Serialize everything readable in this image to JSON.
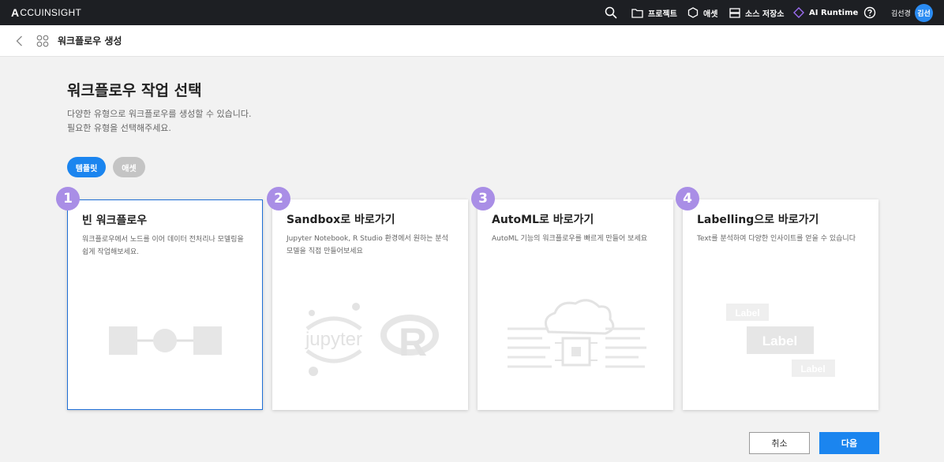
{
  "app": {
    "logo_text": "CCUINSIGHT",
    "logo_mark": "A"
  },
  "nav": {
    "items": [
      {
        "label": "프로젝트",
        "icon": "folder-icon"
      },
      {
        "label": "애셋",
        "icon": "hexagon-icon"
      },
      {
        "label": "소스 저장소",
        "icon": "storage-icon"
      },
      {
        "label": "AI Runtime",
        "icon": "diamond-icon"
      }
    ],
    "user_name": "김선경",
    "avatar_text": "김선"
  },
  "subheader": {
    "title": "워크플로우 생성"
  },
  "page": {
    "title": "워크플로우 작업 선택",
    "description_line1": "다양한 유형으로 워크플로우를 생성할 수 있습니다.",
    "description_line2": "필요한 유형을 선택해주세요."
  },
  "filters": [
    {
      "label": "템플릿",
      "active": true
    },
    {
      "label": "애셋",
      "active": false
    }
  ],
  "cards": [
    {
      "number": "1",
      "title": "빈 워크플로우",
      "description": "워크플로우에서 노드를 이어 데이터 전처리나 모델링을 쉽게 작업해보세요.",
      "selected": true
    },
    {
      "number": "2",
      "title": "Sandbox로 바로가기",
      "description": "Jupyter Notebook, R Studio 환경에서 원하는 분석 모델을 직접 만들어보세요",
      "selected": false,
      "illust_text": "jupyter"
    },
    {
      "number": "3",
      "title": "AutoML로 바로가기",
      "description": "AutoML 기능의 워크플로우를 빠르게 만들어 보세요",
      "selected": false
    },
    {
      "number": "4",
      "title": "Labelling으로 바로가기",
      "description": "Text를 분석하여 다양한 인사이트를 얻을 수 있습니다",
      "selected": false,
      "illust_labels": [
        "Label",
        "Label",
        "Label"
      ]
    }
  ],
  "actions": {
    "cancel_label": "취소",
    "next_label": "다음"
  },
  "colors": {
    "topbar": "#1d1f23",
    "accent": "#1b85ef",
    "badge": "#a98ee6",
    "selected_border": "#1f6fd6"
  }
}
